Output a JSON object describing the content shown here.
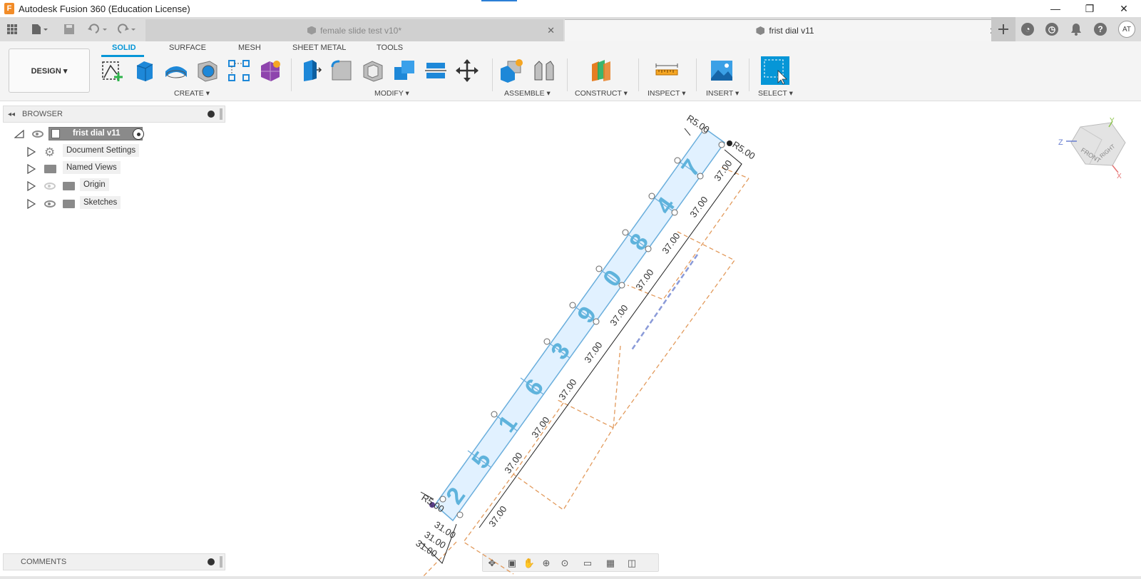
{
  "app": {
    "title": "Autodesk Fusion 360 (Education License)",
    "logo_letter": "F"
  },
  "window_controls": {
    "minimize": "—",
    "restore": "❐",
    "close": "✕"
  },
  "tabs": [
    {
      "label": "female slide test v10*",
      "active": false,
      "close": "✕"
    },
    {
      "label": "frist dial v11",
      "active": true,
      "close": "✕"
    }
  ],
  "header_icons": [
    "grid-icon",
    "file-icon",
    "save-icon",
    "undo-icon",
    "redo-icon",
    "plus-icon",
    "extensions-icon",
    "job-status-icon",
    "notifications-icon",
    "help-icon"
  ],
  "user": {
    "initials": "AT"
  },
  "toolbar": {
    "workspace": "DESIGN ▾",
    "workspace_tabs": [
      "SOLID",
      "SURFACE",
      "MESH",
      "SHEET METAL",
      "TOOLS"
    ],
    "groups": {
      "create": "CREATE ▾",
      "modify": "MODIFY ▾",
      "assemble": "ASSEMBLE ▾",
      "construct": "CONSTRUCT ▾",
      "inspect": "INSPECT ▾",
      "insert": "INSERT ▾",
      "select": "SELECT ▾"
    },
    "accent": "#0696d7"
  },
  "browser": {
    "title": "BROWSER",
    "root": "frist dial v11",
    "items": [
      "Document Settings",
      "Named Views",
      "Origin",
      "Sketches"
    ]
  },
  "comments": {
    "title": "COMMENTS"
  },
  "viewcube": {
    "front": "FRONT",
    "right": "RIGHT",
    "axis_x": "X",
    "axis_y": "Y",
    "axis_z": "Z"
  },
  "canvas": {
    "digits": [
      "2",
      "5",
      "1",
      "6",
      "3",
      "9",
      "0",
      "8",
      "4",
      "7"
    ],
    "dims": {
      "r5": "R5.00",
      "d37": "37.00",
      "d31": "31.00"
    },
    "colors": {
      "sketch_fill": "#dcefff",
      "sketch_line": "#6aaedc",
      "dashed": "#e29a5c",
      "axis": "#8a9ad8"
    }
  }
}
